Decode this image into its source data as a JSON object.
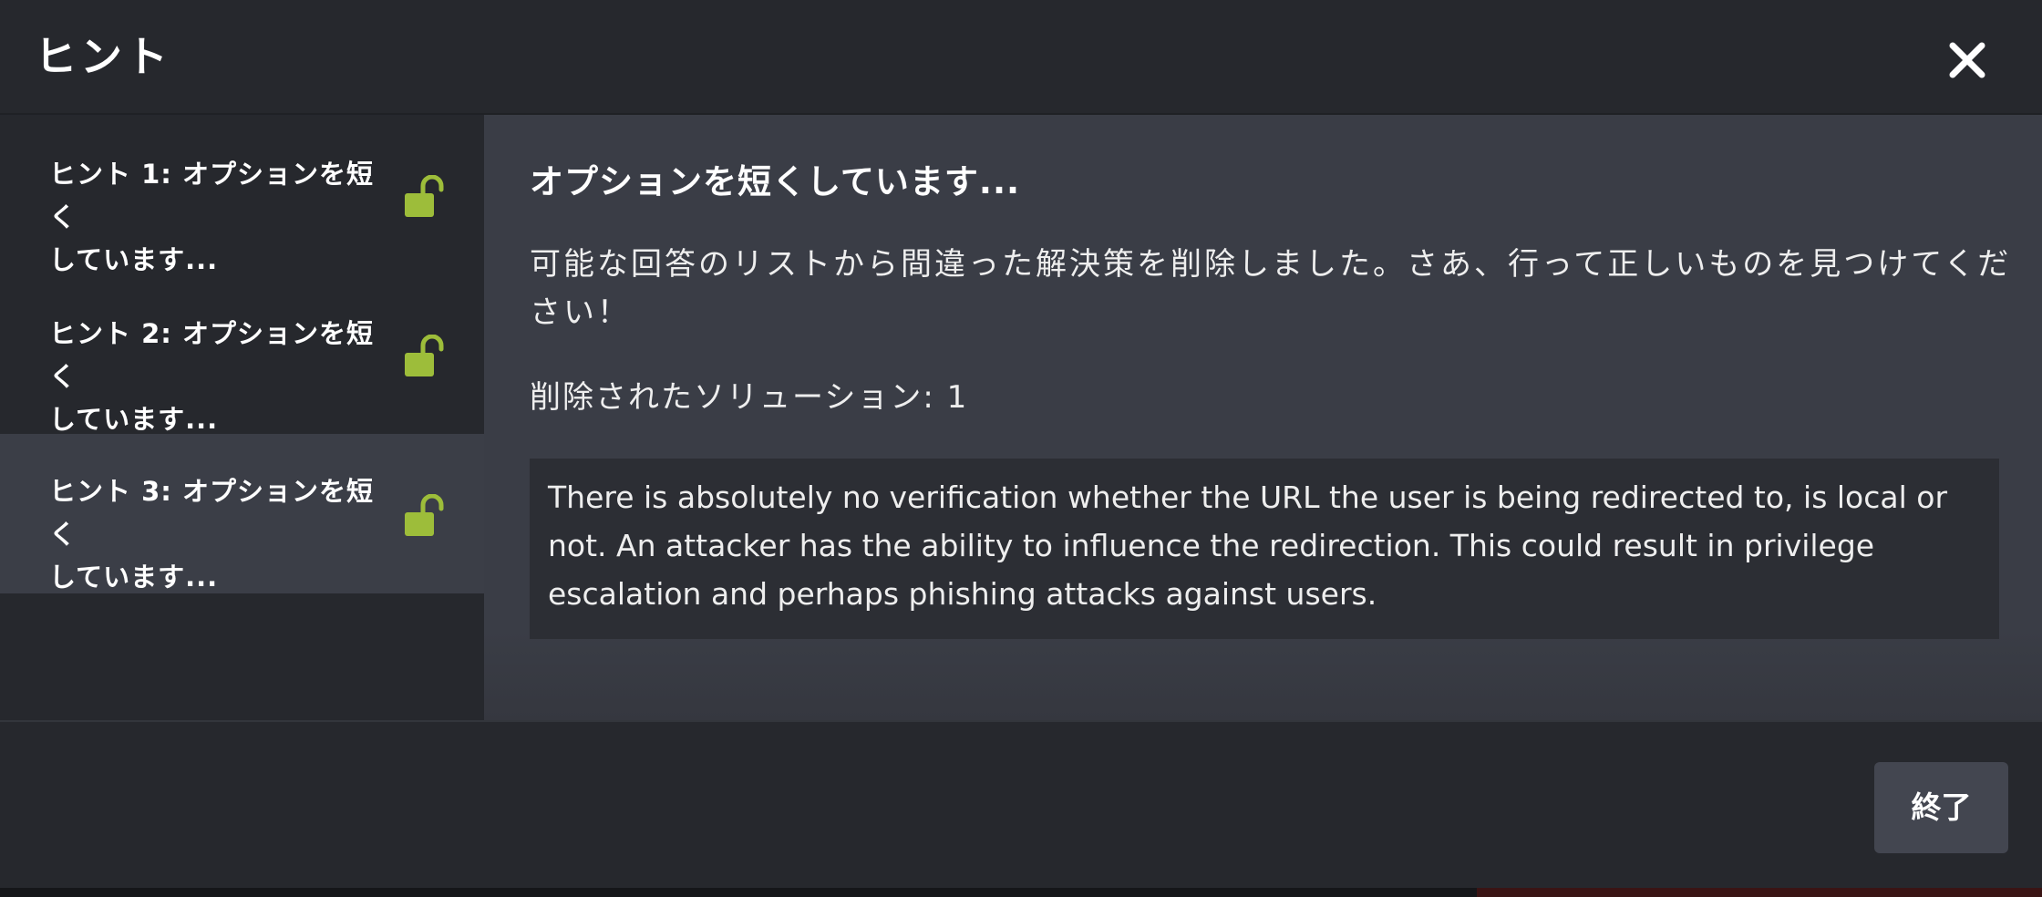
{
  "dialog": {
    "title": "ヒント",
    "close_icon": "close-icon"
  },
  "hints": [
    {
      "line1": "ヒント 1: オプションを短く",
      "line2": "しています...",
      "unlocked": true,
      "active": false
    },
    {
      "line1": "ヒント 2: オプションを短く",
      "line2": "しています...",
      "unlocked": true,
      "active": false
    },
    {
      "line1": "ヒント 3: オプションを短く",
      "line2": "しています...",
      "unlocked": true,
      "active": true
    }
  ],
  "content": {
    "title": "オプションを短くしています...",
    "description": "可能な回答のリストから間違った解決策を削除しました。さあ、行って正しいものを見つけてください！",
    "removed_label": "削除されたソリューション: 1",
    "solution": "There is absolutely no verification whether the URL the user is being redirected to, is local or not. An attacker has the ability to influence the redirection. This could result in privilege escalation and perhaps phishing attacks against users."
  },
  "footer": {
    "finish_label": "終了"
  },
  "colors": {
    "lock_green": "#9dbd3a",
    "active_bg": "#3b3e47",
    "panel_bg": "#26282d"
  }
}
